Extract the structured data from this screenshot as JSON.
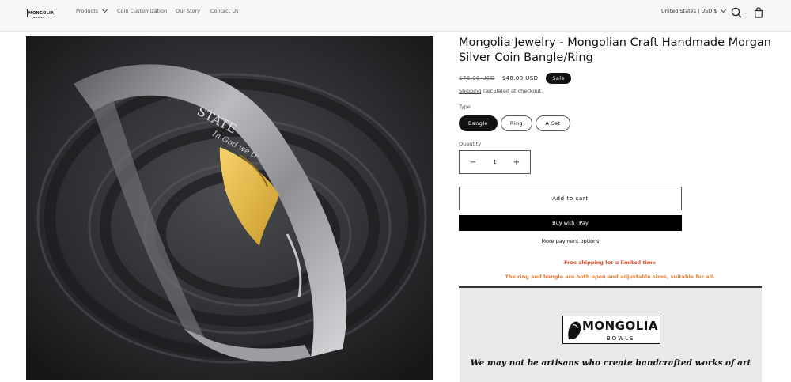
{
  "header": {
    "logo_text": "MONGOLIA",
    "logo_sub": "BOWLS",
    "nav": [
      {
        "label": "Products"
      },
      {
        "label": "Coin Customization"
      },
      {
        "label": "Our Story"
      },
      {
        "label": "Contact Us"
      }
    ],
    "locale": "United States | USD $",
    "icons": {
      "search": "search-icon",
      "cart": "cart-icon"
    }
  },
  "product": {
    "title": "Mongolia Jewelry - Mongolian Craft Handmade Morgan Silver Coin Bangle/Ring",
    "price_old": "$78.00 USD",
    "price_new": "$48.00 USD",
    "badge": "Sale",
    "shipping_link": "Shipping",
    "shipping_text": " calculated at checkout.",
    "type_label": "Type",
    "variants": [
      "Bangle",
      "Ring",
      "A Set"
    ],
    "selected_variant": "Bangle",
    "quantity_label": "Quantity",
    "quantity": "1",
    "add_to_cart": "Add to cart",
    "buy_now": "Buy with Pay",
    "more_payment": "More payment options",
    "free_shipping": "Free shipping for a limited time",
    "note": "The ring and bangle are both open and adjustable sizes, suitable for all."
  },
  "banner": {
    "logo_word": "MONGOLIA",
    "logo_sub": "BOWLS",
    "tagline": "We may not be artisans who create handcrafted works of art"
  },
  "colors": {
    "accent_red": "#e2502a",
    "accent_orange": "#ec7a2b",
    "dark": "#121212"
  }
}
